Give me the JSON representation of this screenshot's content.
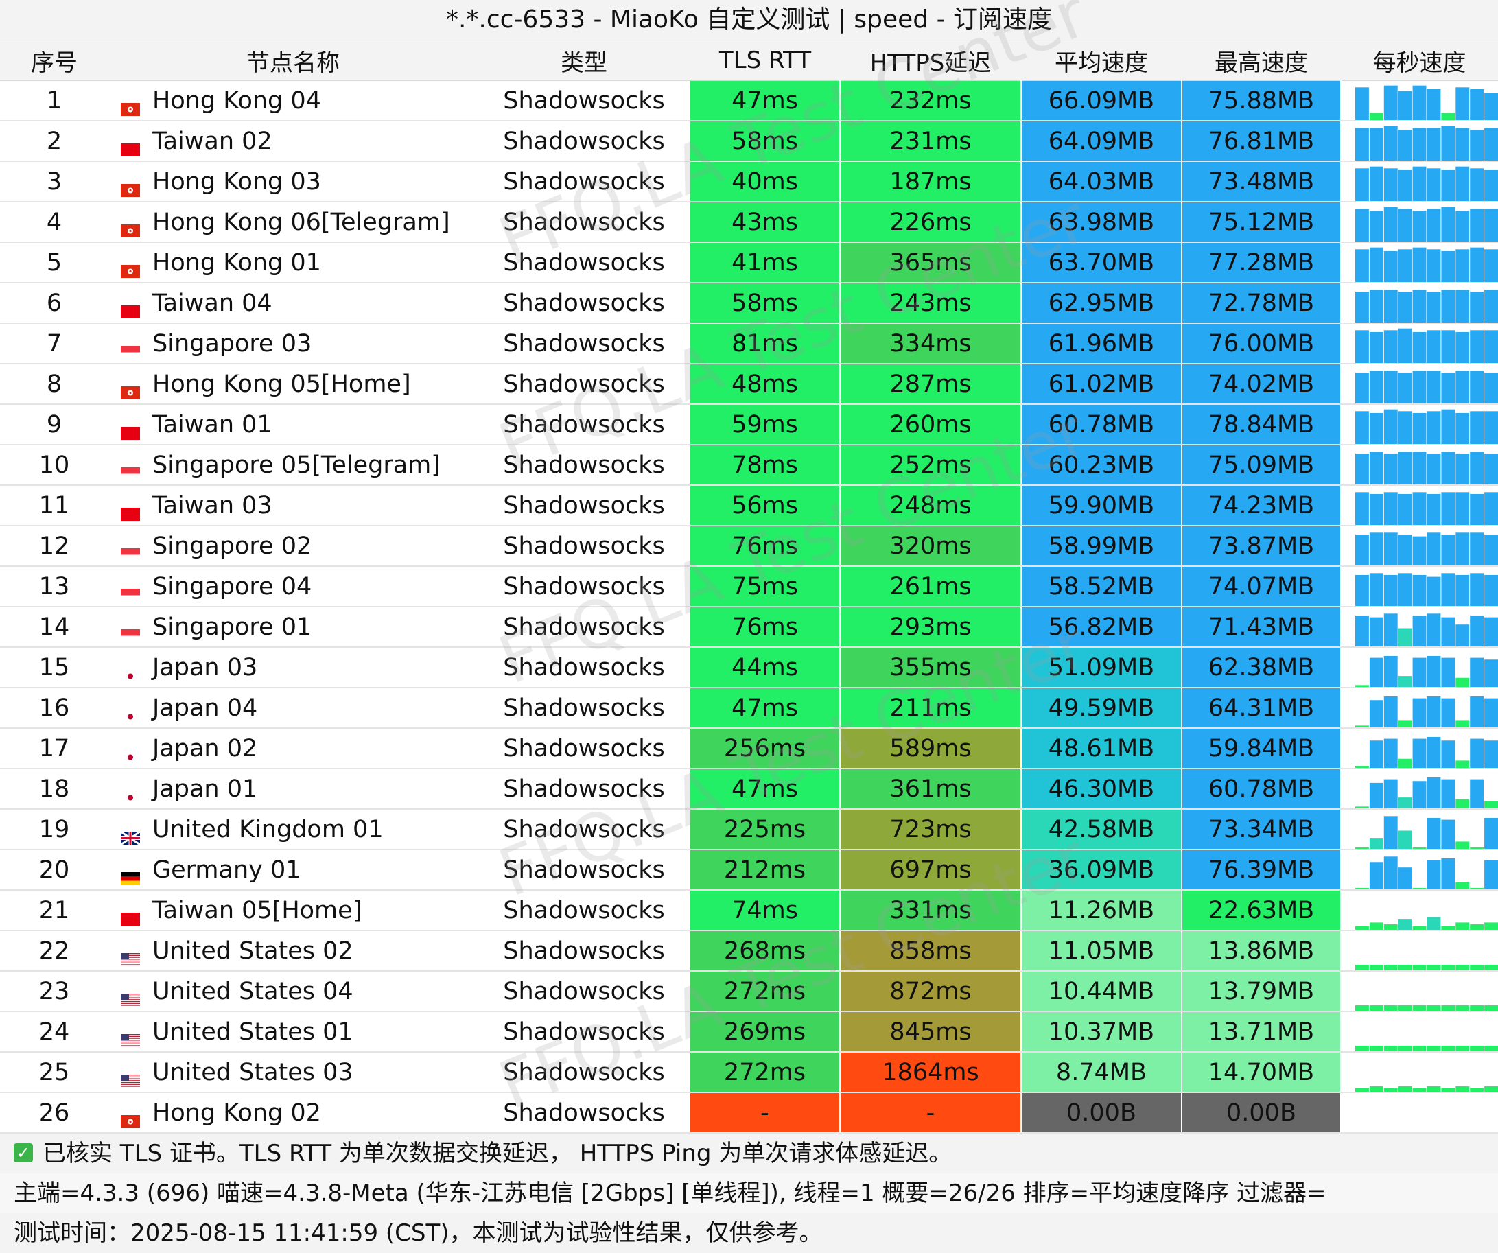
{
  "window": {
    "title": "*.*.cc-6533 - MiaoKo 自定义测试 | speed - 订阅速度"
  },
  "columns": [
    "序号",
    "节点名称",
    "类型",
    "TLS RTT",
    "HTTPS延迟",
    "平均速度",
    "最高速度",
    "每秒速度"
  ],
  "watermark": "FFQ.LA Test Center",
  "colors": {
    "green_fast": "#22ee66",
    "green_mid": "#3fd45b",
    "olive": "#8fa83a",
    "olive_dark": "#a49a38",
    "red": "#ff4a12",
    "blue": "#27a8f2",
    "cyan_blue": "#21c4d6",
    "teal": "#2ad7b6",
    "mint": "#7ef0a6",
    "gray": "#666666"
  },
  "rows": [
    {
      "idx": "1",
      "name": "Hong Kong 04",
      "flag": "hk",
      "type": "Shadowsocks",
      "rtt": "47ms",
      "https": "232ms",
      "avg": "66.09MB",
      "max": "75.88MB",
      "spark": [
        0.9,
        0.2,
        0.95,
        0.8,
        0.95,
        0.85,
        0.2,
        0.9,
        0.85,
        0.75
      ]
    },
    {
      "idx": "2",
      "name": "Taiwan 02",
      "flag": "tw",
      "type": "Shadowsocks",
      "rtt": "58ms",
      "https": "231ms",
      "avg": "64.09MB",
      "max": "76.81MB",
      "spark": [
        0.9,
        0.9,
        0.95,
        0.85,
        0.9,
        0.9,
        0.95,
        0.9,
        0.85,
        0.9
      ]
    },
    {
      "idx": "3",
      "name": "Hong Kong 03",
      "flag": "hk",
      "type": "Shadowsocks",
      "rtt": "40ms",
      "https": "187ms",
      "avg": "64.03MB",
      "max": "73.48MB",
      "spark": [
        0.9,
        0.95,
        0.9,
        0.85,
        0.95,
        0.9,
        0.85,
        0.95,
        0.9,
        0.85
      ]
    },
    {
      "idx": "4",
      "name": "Hong Kong 06[Telegram]",
      "flag": "hk",
      "type": "Shadowsocks",
      "rtt": "43ms",
      "https": "226ms",
      "avg": "63.98MB",
      "max": "75.12MB",
      "spark": [
        0.9,
        0.85,
        0.95,
        0.9,
        0.85,
        0.9,
        0.95,
        0.85,
        0.9,
        0.9
      ]
    },
    {
      "idx": "5",
      "name": "Hong Kong 01",
      "flag": "hk",
      "type": "Shadowsocks",
      "rtt": "41ms",
      "https": "365ms",
      "avg": "63.70MB",
      "max": "77.28MB",
      "spark": [
        0.9,
        0.95,
        0.85,
        0.9,
        0.95,
        0.9,
        0.85,
        0.9,
        0.95,
        0.9
      ]
    },
    {
      "idx": "6",
      "name": "Taiwan 04",
      "flag": "tw",
      "type": "Shadowsocks",
      "rtt": "58ms",
      "https": "243ms",
      "avg": "62.95MB",
      "max": "72.78MB",
      "spark": [
        0.85,
        0.9,
        0.9,
        0.85,
        0.9,
        0.85,
        0.9,
        0.9,
        0.85,
        0.9
      ]
    },
    {
      "idx": "7",
      "name": "Singapore 03",
      "flag": "sg",
      "type": "Shadowsocks",
      "rtt": "81ms",
      "https": "334ms",
      "avg": "61.96MB",
      "max": "76.00MB",
      "spark": [
        0.9,
        0.85,
        0.9,
        0.95,
        0.85,
        0.9,
        0.9,
        0.85,
        0.9,
        0.9
      ]
    },
    {
      "idx": "8",
      "name": "Hong Kong 05[Home]",
      "flag": "hk",
      "type": "Shadowsocks",
      "rtt": "48ms",
      "https": "287ms",
      "avg": "61.02MB",
      "max": "74.02MB",
      "spark": [
        0.85,
        0.9,
        0.9,
        0.85,
        0.9,
        0.9,
        0.85,
        0.9,
        0.9,
        0.85
      ]
    },
    {
      "idx": "9",
      "name": "Taiwan 01",
      "flag": "tw",
      "type": "Shadowsocks",
      "rtt": "59ms",
      "https": "260ms",
      "avg": "60.78MB",
      "max": "78.84MB",
      "spark": [
        0.9,
        0.85,
        0.95,
        0.9,
        0.85,
        0.9,
        0.95,
        0.85,
        0.9,
        0.9
      ]
    },
    {
      "idx": "10",
      "name": "Singapore 05[Telegram]",
      "flag": "sg",
      "type": "Shadowsocks",
      "rtt": "78ms",
      "https": "252ms",
      "avg": "60.23MB",
      "max": "75.09MB",
      "spark": [
        0.85,
        0.9,
        0.85,
        0.9,
        0.9,
        0.85,
        0.9,
        0.85,
        0.9,
        0.85
      ]
    },
    {
      "idx": "11",
      "name": "Taiwan 03",
      "flag": "tw",
      "type": "Shadowsocks",
      "rtt": "56ms",
      "https": "248ms",
      "avg": "59.90MB",
      "max": "74.23MB",
      "spark": [
        0.9,
        0.85,
        0.9,
        0.85,
        0.9,
        0.85,
        0.9,
        0.9,
        0.85,
        0.9
      ]
    },
    {
      "idx": "12",
      "name": "Singapore 02",
      "flag": "sg",
      "type": "Shadowsocks",
      "rtt": "76ms",
      "https": "320ms",
      "avg": "58.99MB",
      "max": "73.87MB",
      "spark": [
        0.85,
        0.9,
        0.9,
        0.85,
        0.8,
        0.9,
        0.85,
        0.9,
        0.9,
        0.85
      ]
    },
    {
      "idx": "13",
      "name": "Singapore 04",
      "flag": "sg",
      "type": "Shadowsocks",
      "rtt": "75ms",
      "https": "261ms",
      "avg": "58.52MB",
      "max": "74.07MB",
      "spark": [
        0.85,
        0.9,
        0.85,
        0.9,
        0.85,
        0.8,
        0.9,
        0.85,
        0.9,
        0.85
      ]
    },
    {
      "idx": "14",
      "name": "Singapore 01",
      "flag": "sg",
      "type": "Shadowsocks",
      "rtt": "76ms",
      "https": "293ms",
      "avg": "56.82MB",
      "max": "71.43MB",
      "spark": [
        0.85,
        0.8,
        0.9,
        0.5,
        0.85,
        0.9,
        0.8,
        0.6,
        0.85,
        0.8
      ]
    },
    {
      "idx": "15",
      "name": "Japan 03",
      "flag": "jp",
      "type": "Shadowsocks",
      "rtt": "44ms",
      "https": "355ms",
      "avg": "51.09MB",
      "max": "62.38MB",
      "spark": [
        0.05,
        0.8,
        0.85,
        0.3,
        0.8,
        0.85,
        0.8,
        0.25,
        0.8,
        0.75
      ]
    },
    {
      "idx": "16",
      "name": "Japan 04",
      "flag": "jp",
      "type": "Shadowsocks",
      "rtt": "47ms",
      "https": "211ms",
      "avg": "49.59MB",
      "max": "64.31MB",
      "spark": [
        0.05,
        0.75,
        0.85,
        0.2,
        0.8,
        0.85,
        0.8,
        0.2,
        0.85,
        0.8
      ]
    },
    {
      "idx": "17",
      "name": "Japan 02",
      "flag": "jp",
      "type": "Shadowsocks",
      "rtt": "256ms",
      "https": "589ms",
      "avg": "48.61MB",
      "max": "59.84MB",
      "spark": [
        0.05,
        0.75,
        0.8,
        0.25,
        0.8,
        0.85,
        0.75,
        0.2,
        0.8,
        0.75
      ]
    },
    {
      "idx": "18",
      "name": "Japan 01",
      "flag": "jp",
      "type": "Shadowsocks",
      "rtt": "47ms",
      "https": "361ms",
      "avg": "46.30MB",
      "max": "60.78MB",
      "spark": [
        0.05,
        0.7,
        0.8,
        0.3,
        0.75,
        0.85,
        0.8,
        0.25,
        0.8,
        0.2
      ]
    },
    {
      "idx": "19",
      "name": "United Kingdom 01",
      "flag": "gb",
      "type": "Shadowsocks",
      "rtt": "225ms",
      "https": "723ms",
      "avg": "42.58MB",
      "max": "73.34MB",
      "spark": [
        0.0,
        0.3,
        0.9,
        0.5,
        0.0,
        0.85,
        0.8,
        0.2,
        0.0,
        0.85
      ]
    },
    {
      "idx": "20",
      "name": "Germany 01",
      "flag": "de",
      "type": "Shadowsocks",
      "rtt": "212ms",
      "https": "697ms",
      "avg": "36.09MB",
      "max": "76.39MB",
      "spark": [
        0.0,
        0.75,
        0.9,
        0.6,
        0.0,
        0.8,
        0.85,
        0.2,
        0.0,
        0.8
      ]
    },
    {
      "idx": "21",
      "name": "Taiwan 05[Home]",
      "flag": "tw",
      "type": "Shadowsocks",
      "rtt": "74ms",
      "https": "331ms",
      "avg": "11.26MB",
      "max": "22.63MB",
      "spark": [
        0.1,
        0.2,
        0.15,
        0.3,
        0.1,
        0.35,
        0.1,
        0.2,
        0.15,
        0.2
      ]
    },
    {
      "idx": "22",
      "name": "United States 02",
      "flag": "us",
      "type": "Shadowsocks",
      "rtt": "268ms",
      "https": "858ms",
      "avg": "11.05MB",
      "max": "13.86MB",
      "spark": [
        0.15,
        0.15,
        0.15,
        0.15,
        0.15,
        0.15,
        0.15,
        0.15,
        0.15,
        0.15
      ]
    },
    {
      "idx": "23",
      "name": "United States 04",
      "flag": "us",
      "type": "Shadowsocks",
      "rtt": "272ms",
      "https": "872ms",
      "avg": "10.44MB",
      "max": "13.79MB",
      "spark": [
        0.15,
        0.15,
        0.15,
        0.15,
        0.15,
        0.15,
        0.15,
        0.15,
        0.15,
        0.15
      ]
    },
    {
      "idx": "24",
      "name": "United States 01",
      "flag": "us",
      "type": "Shadowsocks",
      "rtt": "269ms",
      "https": "845ms",
      "avg": "10.37MB",
      "max": "13.71MB",
      "spark": [
        0.15,
        0.15,
        0.15,
        0.15,
        0.15,
        0.15,
        0.15,
        0.15,
        0.15,
        0.15
      ]
    },
    {
      "idx": "25",
      "name": "United States 03",
      "flag": "us",
      "type": "Shadowsocks",
      "rtt": "272ms",
      "https": "1864ms",
      "avg": "8.74MB",
      "max": "14.70MB",
      "spark": [
        0.1,
        0.15,
        0.1,
        0.15,
        0.1,
        0.15,
        0.1,
        0.15,
        0.1,
        0.15
      ]
    },
    {
      "idx": "26",
      "name": "Hong Kong 02",
      "flag": "hk",
      "type": "Shadowsocks",
      "rtt": "-",
      "https": "-",
      "avg": "0.00B",
      "max": "0.00B",
      "spark": []
    }
  ],
  "footer": {
    "line1": "已核实 TLS 证书。TLS RTT 为单次数据交换延迟， HTTPS Ping 为单次请求体感延迟。",
    "line2": "主端=4.3.3 (696) 喵速=4.3.8-Meta (华东-江苏电信 [2Gbps] [单线程]), 线程=1 概要=26/26 排序=平均速度降序 过滤器=",
    "line3": "测试时间：2025-08-15 11:41:59 (CST)，本测试为试验性结果，仅供参考。"
  }
}
